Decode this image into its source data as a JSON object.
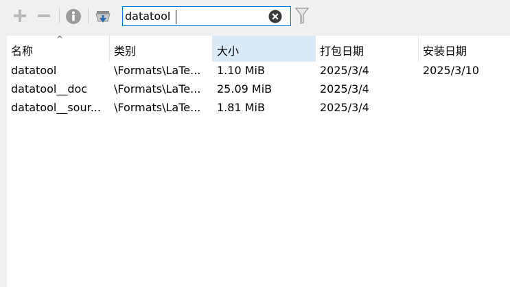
{
  "toolbar": {
    "add_icon": "plus-icon",
    "remove_icon": "minus-icon",
    "info_icon": "info-icon",
    "install_icon": "install-icon",
    "filter_icon": "filter-icon"
  },
  "search": {
    "value": "datatool",
    "clear_icon": "clear-icon"
  },
  "table": {
    "columns": [
      {
        "label": "名称"
      },
      {
        "label": "类别"
      },
      {
        "label": "大小"
      },
      {
        "label": "打包日期"
      },
      {
        "label": "安装日期"
      }
    ],
    "sort_indicator": "^",
    "rows": [
      {
        "name": "datatool",
        "category": "\\Formats\\LaTe...",
        "size": "1.10 MiB",
        "packed": "2025/3/4",
        "installed": "2025/3/10"
      },
      {
        "name": "datatool__doc",
        "category": "\\Formats\\LaTe...",
        "size": "25.09 MiB",
        "packed": "2025/3/4",
        "installed": ""
      },
      {
        "name": "datatool__sour...",
        "category": "\\Formats\\LaTe...",
        "size": "1.81 MiB",
        "packed": "2025/3/4",
        "installed": ""
      }
    ]
  },
  "colors": {
    "sorted_header": "#d9ebf9",
    "search_border": "#0078d7",
    "install_icon_blue": "#2a6fb5"
  }
}
